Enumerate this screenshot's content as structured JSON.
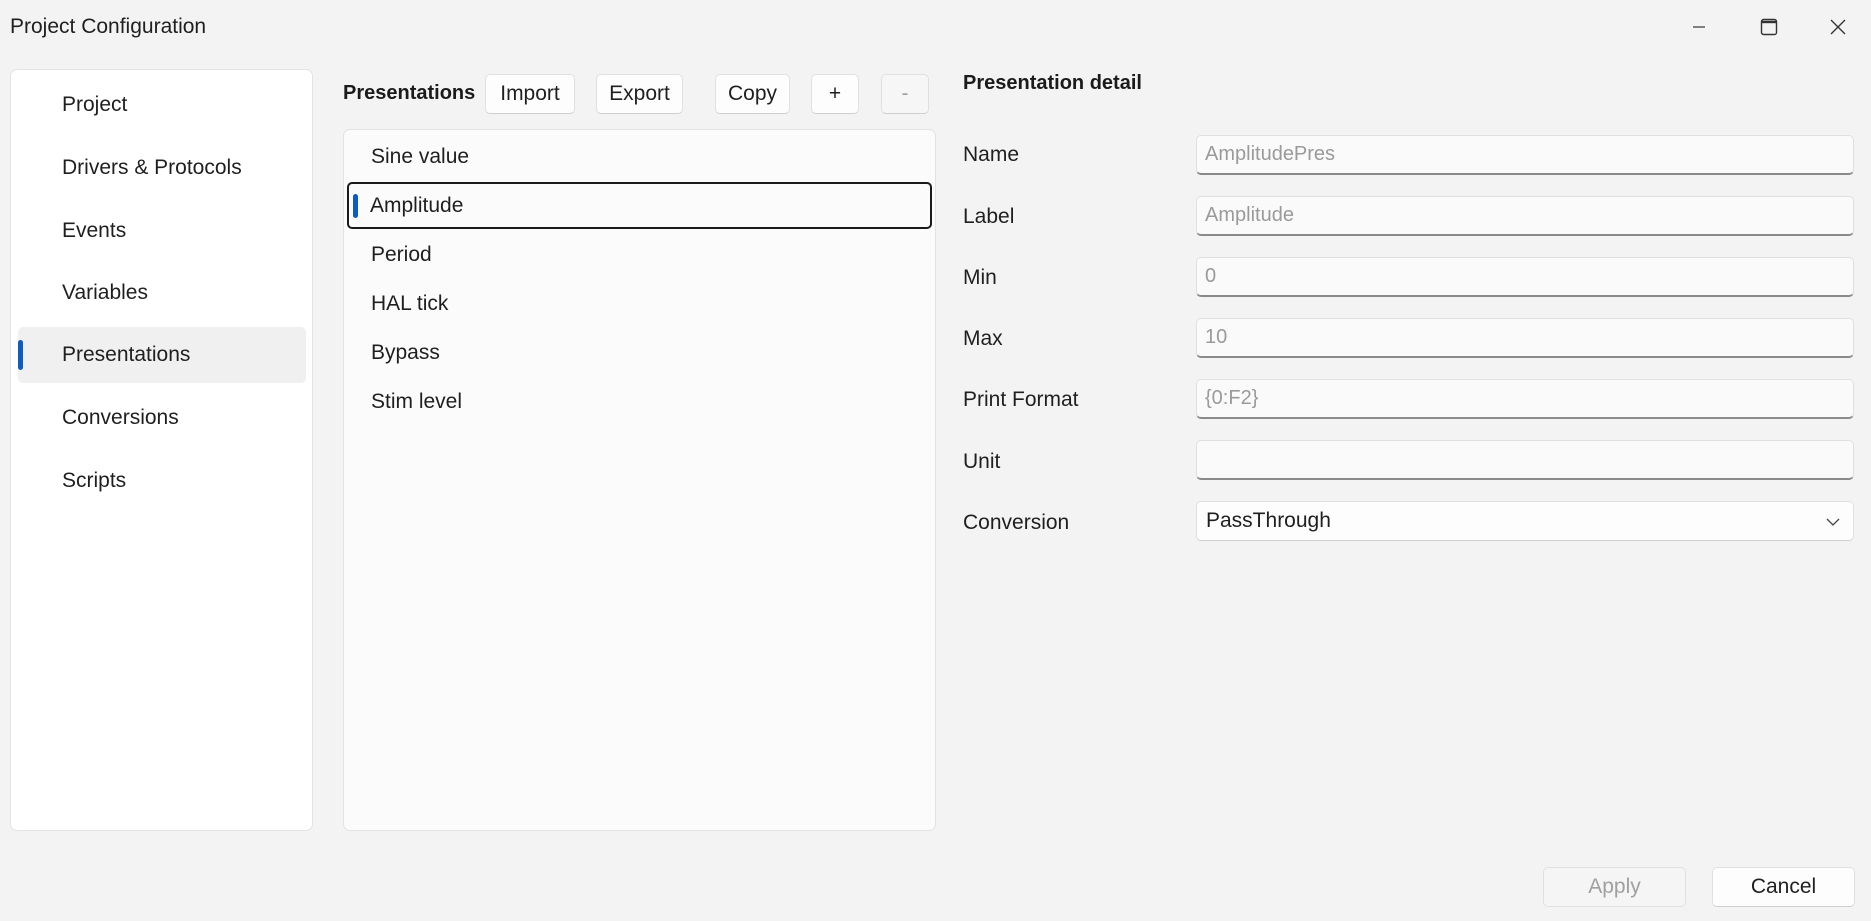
{
  "window": {
    "title": "Project Configuration"
  },
  "nav": {
    "items": [
      {
        "label": "Project"
      },
      {
        "label": "Drivers & Protocols"
      },
      {
        "label": "Events"
      },
      {
        "label": "Variables"
      },
      {
        "label": "Presentations"
      },
      {
        "label": "Conversions"
      },
      {
        "label": "Scripts"
      }
    ],
    "selected": "Presentations"
  },
  "presentations": {
    "header": "Presentations",
    "toolbar": {
      "import_label": "Import",
      "export_label": "Export",
      "copy_label": "Copy",
      "add_label": "+",
      "remove_label": "-"
    },
    "items": [
      {
        "label": "Sine value"
      },
      {
        "label": "Amplitude"
      },
      {
        "label": "Period"
      },
      {
        "label": "HAL tick"
      },
      {
        "label": "Bypass"
      },
      {
        "label": "Stim level"
      }
    ],
    "selected": "Amplitude"
  },
  "detail": {
    "header": "Presentation detail",
    "fields": {
      "name": {
        "label": "Name",
        "placeholder": "AmplitudePres"
      },
      "label": {
        "label": "Label",
        "placeholder": "Amplitude"
      },
      "min": {
        "label": "Min",
        "placeholder": "0"
      },
      "max": {
        "label": "Max",
        "placeholder": "10"
      },
      "print_format": {
        "label": "Print Format",
        "placeholder": "{0:F2}"
      },
      "unit": {
        "label": "Unit",
        "placeholder": ""
      },
      "conversion": {
        "label": "Conversion",
        "value": "PassThrough"
      }
    }
  },
  "footer": {
    "apply_label": "Apply",
    "cancel_label": "Cancel"
  },
  "colors": {
    "accent": "#0f5cc0",
    "background": "#f3f3f3",
    "panel": "#ffffff"
  }
}
